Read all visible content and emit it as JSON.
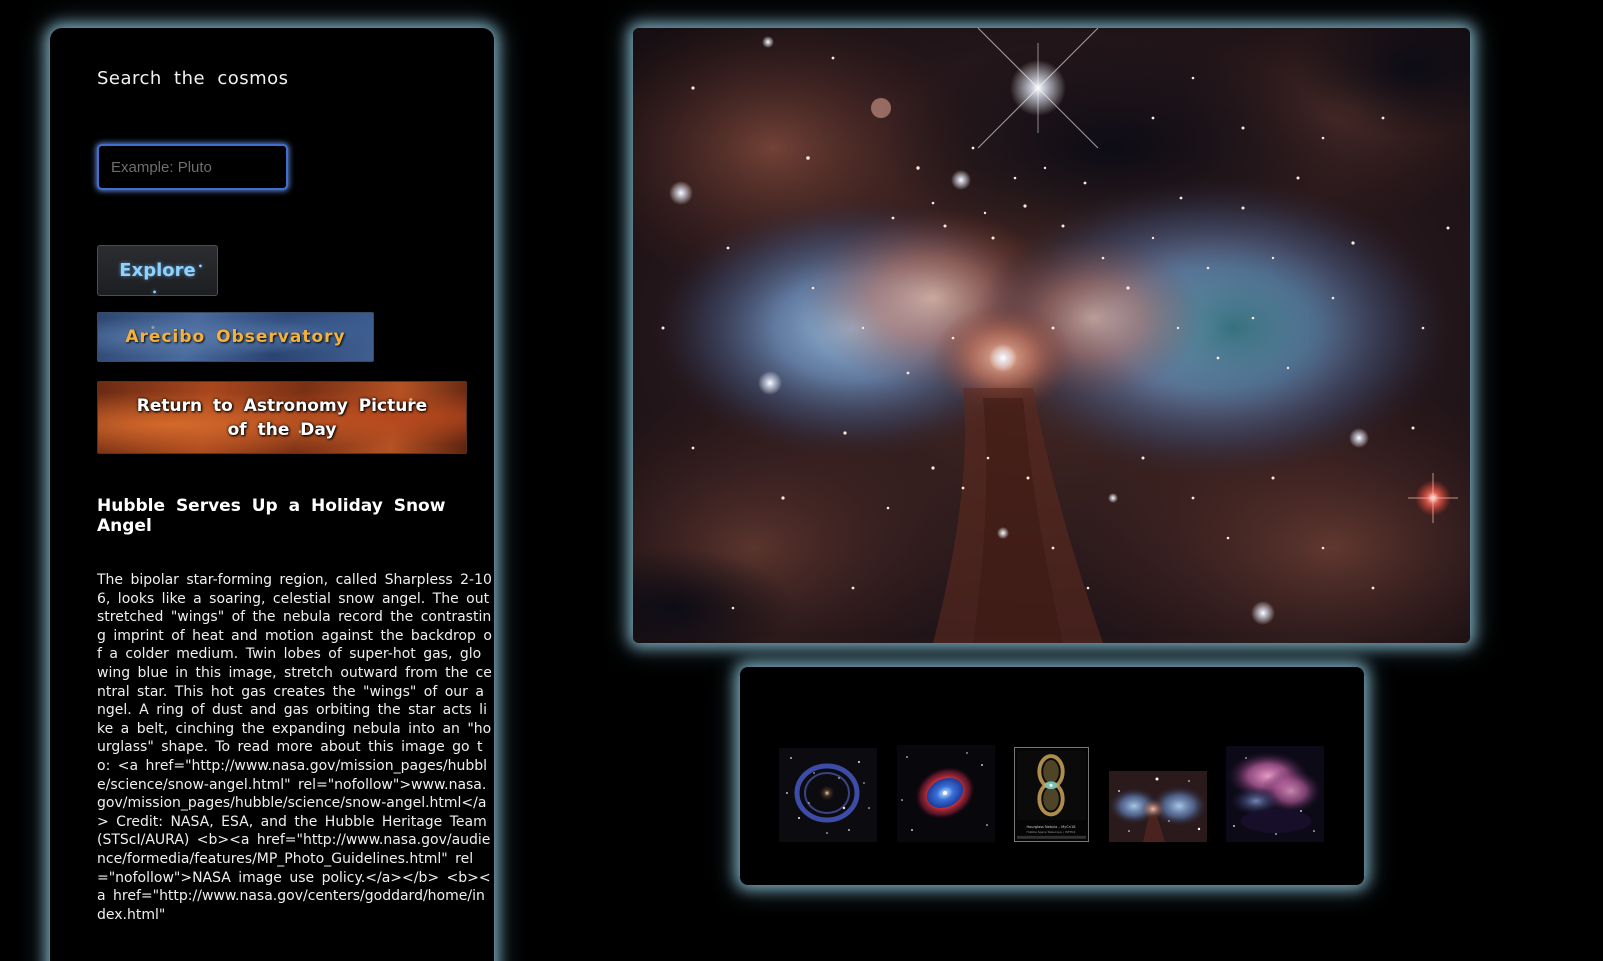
{
  "sidebar": {
    "search_title": "Search the cosmos",
    "search_placeholder": "Example: Pluto",
    "explore_label": "Explore",
    "arecibo_label": "Arecibo Observatory",
    "apod_label": "Return to Astronomy Picture of the Day"
  },
  "apod": {
    "title": "Hubble Serves Up a Holiday Snow Angel",
    "description": "The bipolar star-forming region, called Sharpless 2-106, looks like a soaring, celestial snow angel. The outstretched \"wings\" of the nebula record the contrasting imprint of heat and motion against the backdrop of a colder medium. Twin lobes of super-hot gas, glowing blue in this image, stretch outward from the central star. This hot gas creates the \"wings\" of our angel. A ring of dust and gas orbiting the star acts like a belt, cinching the expanding nebula into an \"hourglass\" shape. To read more about this image go to: <a href=\"http://www.nasa.gov/mission_pages/hubble/science/snow-angel.html\" rel=\"nofollow\">www.nasa.gov/mission_pages/hubble/science/snow-angel.html</a> Credit: NASA, ESA, and the Hubble Heritage Team (STScI/AURA) <b><a href=\"http://www.nasa.gov/audience/formedia/features/MP_Photo_Guidelines.html\" rel=\"nofollow\">NASA image use policy.</a></b> <b><a href=\"http://www.nasa.gov/centers/goddard/home/index.html\""
  },
  "main_image": {
    "alt": "Sharpless 2-106 snow angel nebula"
  },
  "thumbnails": [
    {
      "id": "ring-nebula-stars"
    },
    {
      "id": "planetary-nebula-blue-eye"
    },
    {
      "id": "hourglass-nebula"
    },
    {
      "id": "snow-angel-nebula"
    },
    {
      "id": "pink-cloud-nebula"
    }
  ],
  "thumbnail_caption": {
    "line1": "Hourglass Nebula – MyCn18",
    "line2": "Hubble Space Telescope • WFPC2"
  },
  "colors": {
    "glow": "#96cde1",
    "input_border": "#3f6fd0",
    "explore_text": "#8fd2ff",
    "arecibo_text": "#f5b23a"
  }
}
